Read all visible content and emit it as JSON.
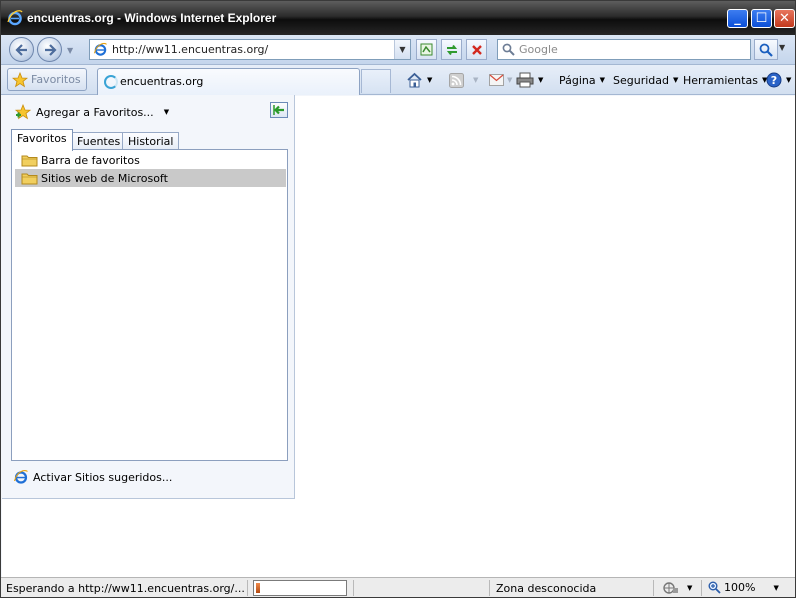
{
  "window": {
    "title": "encuentras.org - Windows Internet Explorer"
  },
  "nav": {
    "url": "http://ww11.encuentras.org/",
    "search_placeholder": "Google"
  },
  "tabbar": {
    "favorites_label": "Favoritos",
    "tab_title": "encuentras.org",
    "commands": {
      "page": "Página",
      "safety": "Seguridad",
      "tools": "Herramientas"
    }
  },
  "favorites_center": {
    "add_label": "Agregar a Favoritos...",
    "tabs": [
      "Favoritos",
      "Fuentes",
      "Historial"
    ],
    "items": [
      "Barra de favoritos",
      "Sitios web de Microsoft"
    ],
    "selected_index": 1,
    "suggested_sites": "Activar Sitios sugeridos..."
  },
  "status": {
    "text": "Esperando a http://ww11.encuentras.org/...",
    "progress": 0.05,
    "zone": "Zona desconocida",
    "zoom": "100%"
  },
  "colors": {
    "selection": "#c9c9c9",
    "ie_blue": "#1e6fd6",
    "folder": "#f1cf5f"
  }
}
